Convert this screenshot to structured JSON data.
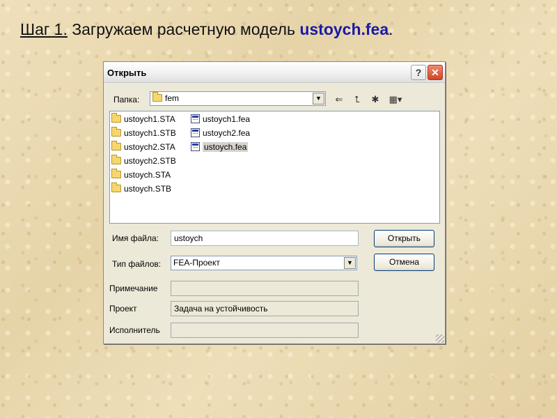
{
  "heading": {
    "step": "Шаг 1.",
    "text": " Загружаем расчетную модель ",
    "filename": "ustoych.fea",
    "period": "."
  },
  "dialog": {
    "title": "Открыть",
    "help_label": "?",
    "close_label": "✕",
    "folder_label": "Папка:",
    "folder_value": "fem",
    "files": [
      {
        "name": "ustoych1.STA",
        "type": "folder"
      },
      {
        "name": "ustoych1.STB",
        "type": "folder"
      },
      {
        "name": "ustoych2.STA",
        "type": "folder"
      },
      {
        "name": "ustoych2.STB",
        "type": "folder"
      },
      {
        "name": "ustoych.STA",
        "type": "folder"
      },
      {
        "name": "ustoych.STB",
        "type": "folder"
      },
      {
        "name": "ustoych1.fea",
        "type": "file"
      },
      {
        "name": "ustoych2.fea",
        "type": "file"
      },
      {
        "name": "ustoych.fea",
        "type": "file",
        "selected": true
      }
    ],
    "filename_label": "Имя файла:",
    "filename_value": "ustoych",
    "filetype_label": "Тип файлов:",
    "filetype_value": "FEA-Проект",
    "note_label": "Примечание",
    "note_value": "",
    "project_label": "Проект",
    "project_value": "Задача на устойчивость",
    "author_label": "Исполнитель",
    "author_value": "",
    "open_button": "Открыть",
    "cancel_button": "Отмена"
  },
  "icons": [
    "folder-icon",
    "back-arrow-icon",
    "up-folder-icon",
    "new-folder-icon",
    "view-menu-icon",
    "fea-file-icon",
    "help-icon",
    "close-icon"
  ],
  "colors": {
    "filename_highlight": "#1a1aa6",
    "close_button": "#d24527",
    "selection": "#d6d3ce"
  }
}
